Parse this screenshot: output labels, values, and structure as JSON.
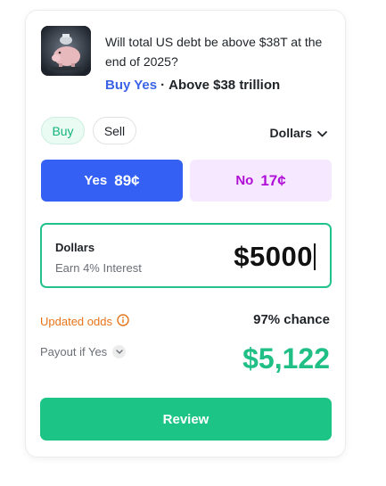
{
  "market": {
    "question": "Will total US debt be above $38T at the end of 2025?",
    "selected_side": "Buy Yes",
    "separator": "·",
    "outcome_label": "Above $38 trillion"
  },
  "tabs": {
    "buy": "Buy",
    "sell": "Sell",
    "active": "buy"
  },
  "currency": {
    "selected": "Dollars"
  },
  "sides": {
    "yes": {
      "label": "Yes",
      "price": "89¢"
    },
    "no": {
      "label": "No",
      "price": "17¢"
    }
  },
  "amount": {
    "title": "Dollars",
    "subtitle": "Earn 4% Interest",
    "value": "$5000"
  },
  "odds": {
    "label": "Updated odds",
    "value": "97% chance"
  },
  "payout": {
    "label": "Payout if Yes",
    "value": "$5,122"
  },
  "review": {
    "label": "Review"
  },
  "colors": {
    "yes": "#3461f4",
    "no_bg": "#f6e8ff",
    "no_text": "#b10fd8",
    "accent_green": "#1cc486",
    "odds_orange": "#e8741a"
  },
  "icons": {
    "info": "info-circle-icon",
    "chevron": "chevron-down-icon"
  }
}
